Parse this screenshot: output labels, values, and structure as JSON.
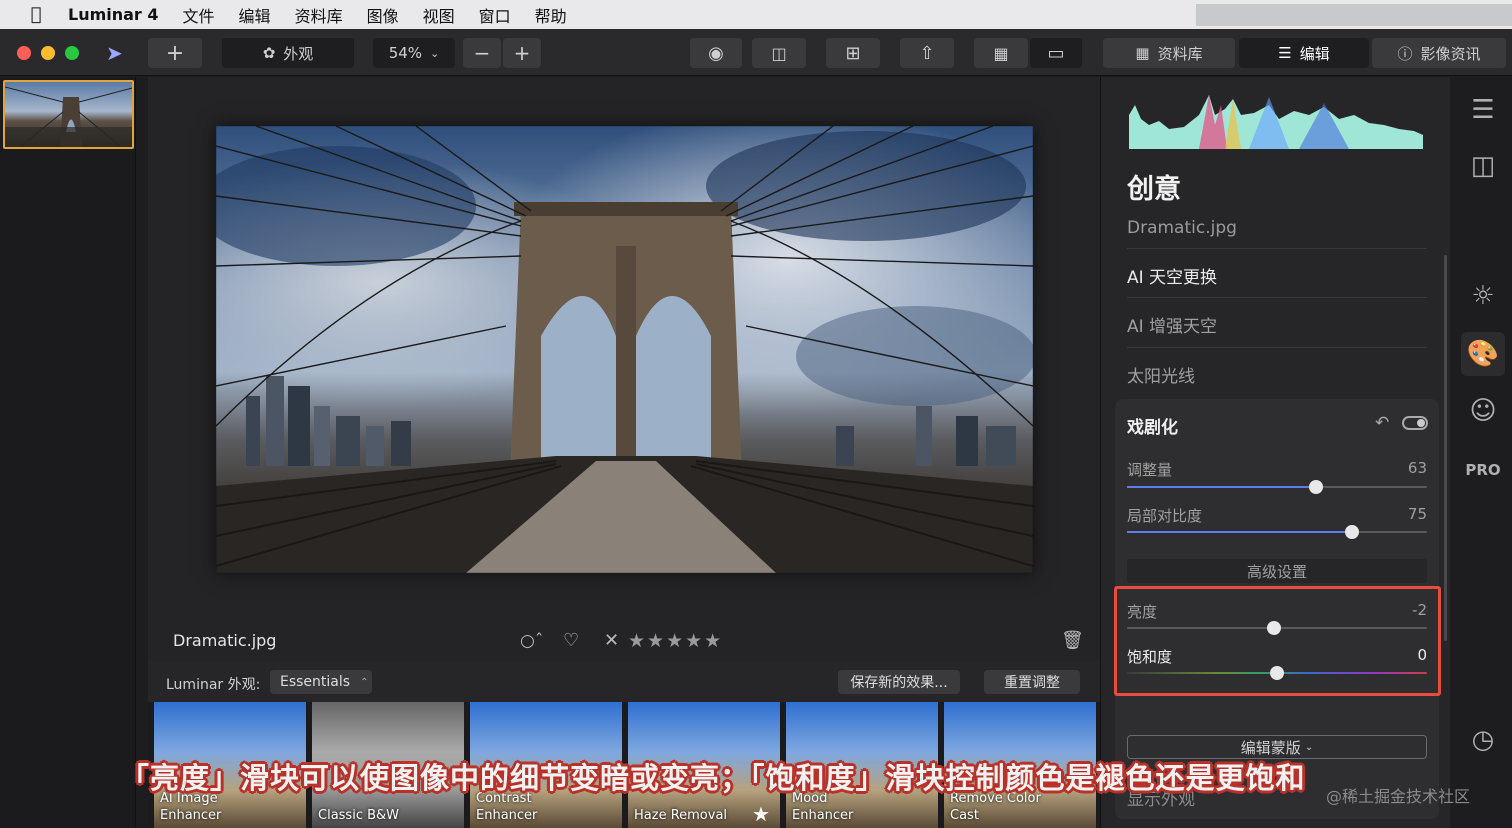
{
  "menubar": {
    "app": "Luminar 4",
    "items": [
      "文件",
      "编辑",
      "资料库",
      "图像",
      "视图",
      "窗口",
      "帮助"
    ]
  },
  "toolbar": {
    "looks_label": "外观",
    "zoom": "54%",
    "tab_library": "资料库",
    "tab_edit": "编辑",
    "tab_info": "影像资讯"
  },
  "canvas": {
    "filename": "Dramatic.jpg",
    "rating_stars": 5
  },
  "looks": {
    "label": "Luminar 外观:",
    "category": "Essentials",
    "save_btn": "保存新的效果...",
    "reset_btn": "重置调整",
    "items": [
      {
        "name1": "AI Image",
        "name2": "Enhancer"
      },
      {
        "name1": "",
        "name2": "Classic B&W"
      },
      {
        "name1": "Contrast",
        "name2": "Enhancer"
      },
      {
        "name1": "",
        "name2": "Haze Removal"
      },
      {
        "name1": "Mood",
        "name2": "Enhancer"
      },
      {
        "name1": "Remove Color",
        "name2": "Cast"
      }
    ]
  },
  "panel": {
    "title": "创意",
    "subtitle": "Dramatic.jpg",
    "rows": [
      "AI 天空更换",
      "AI 增强天空",
      "太阳光线"
    ],
    "card": {
      "title": "戏剧化",
      "amount_label": "调整量",
      "amount_value": "63",
      "local_label": "局部对比度",
      "local_value": "75",
      "advanced": "高级设置",
      "brightness_label": "亮度",
      "brightness_value": "-2",
      "saturation_label": "饱和度",
      "saturation_value": "0",
      "mask": "编辑蒙版"
    },
    "next_row": "显示外观"
  },
  "caption": "「亮度」滑块可以使图像中的细节变暗或变亮；「饱和度」滑块控制颜色是褪色还是更饱和",
  "watermark": "@稀土掘金技术社区",
  "colors": {
    "accent": "#5b7ee8",
    "highlight": "#e74c3c",
    "selection": "#e0a33d"
  },
  "sliders": {
    "amount_pct": 63,
    "local_pct": 75,
    "brightness_pct": 49,
    "saturation_pct": 50
  }
}
